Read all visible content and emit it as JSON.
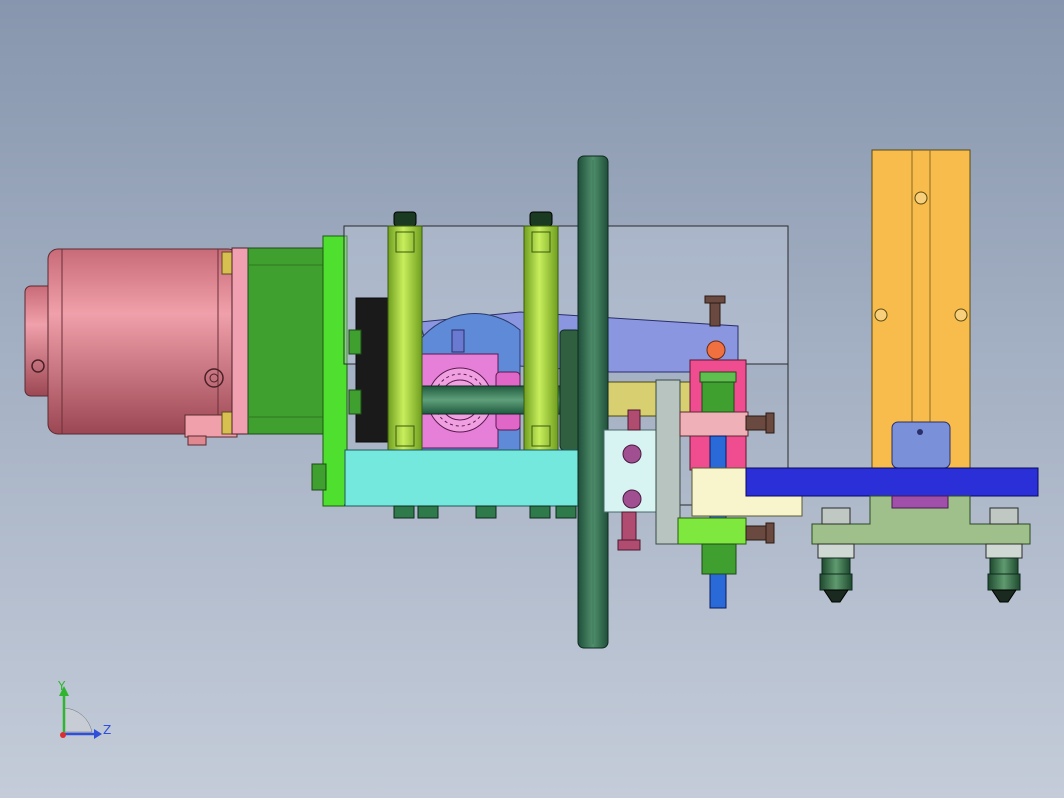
{
  "viewport": {
    "background_top": "#8796ae",
    "background_bottom": "#c4ccd9"
  },
  "triad": {
    "y_label": "Y",
    "z_label": "Z",
    "y_color": "#2fb52f",
    "z_color": "#2f4fd8",
    "x_color": "#d83030"
  },
  "colors": {
    "motor": "#e0808e",
    "gearbox": "#3f9f2f",
    "flange": "#4fe02f",
    "rod": "#9fd63c",
    "base_block": "#74e8dc",
    "disc": "#2f6f4f",
    "gear": "#e67fd8",
    "bracket": "#8a96e0",
    "yellow_column": "#f8bc4c",
    "blue_bar": "#2a2fd8",
    "nozzle_plate": "#9fc08a"
  }
}
